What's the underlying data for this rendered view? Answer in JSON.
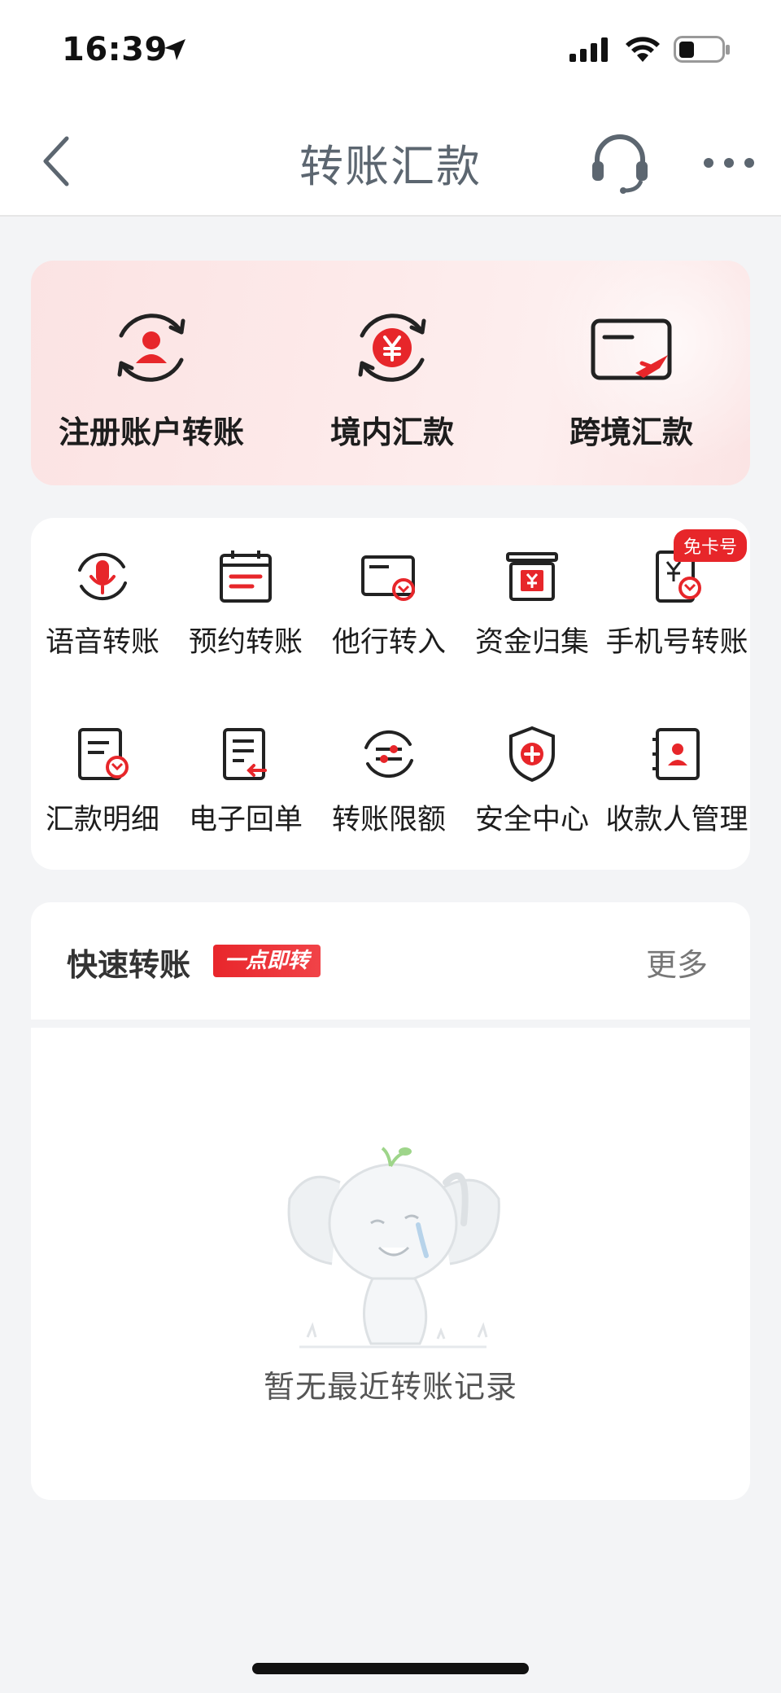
{
  "status_bar": {
    "time": "16:39"
  },
  "header": {
    "title": "转账汇款"
  },
  "primary_actions": [
    {
      "label": "注册账户转账",
      "icon": "user-transfer-icon"
    },
    {
      "label": "境内汇款",
      "icon": "yuan-exchange-icon"
    },
    {
      "label": "跨境汇款",
      "icon": "card-plane-icon"
    }
  ],
  "grid_actions": [
    {
      "label": "语音转账",
      "icon": "microphone-icon"
    },
    {
      "label": "预约转账",
      "icon": "calendar-icon"
    },
    {
      "label": "他行转入",
      "icon": "card-in-icon"
    },
    {
      "label": "资金归集",
      "icon": "fund-collect-icon"
    },
    {
      "label": "手机号转账",
      "icon": "phone-transfer-icon",
      "badge": "免卡号"
    },
    {
      "label": "汇款明细",
      "icon": "detail-icon"
    },
    {
      "label": "电子回单",
      "icon": "receipt-icon"
    },
    {
      "label": "转账限额",
      "icon": "limit-icon"
    },
    {
      "label": "安全中心",
      "icon": "shield-icon"
    },
    {
      "label": "收款人管理",
      "icon": "payee-icon"
    }
  ],
  "quick_transfer": {
    "title": "快速转账",
    "badge": "一点即转",
    "more": "更多",
    "empty_text": "暂无最近转账记录"
  },
  "colors": {
    "accent": "#e7262a",
    "title": "#5c6670"
  }
}
